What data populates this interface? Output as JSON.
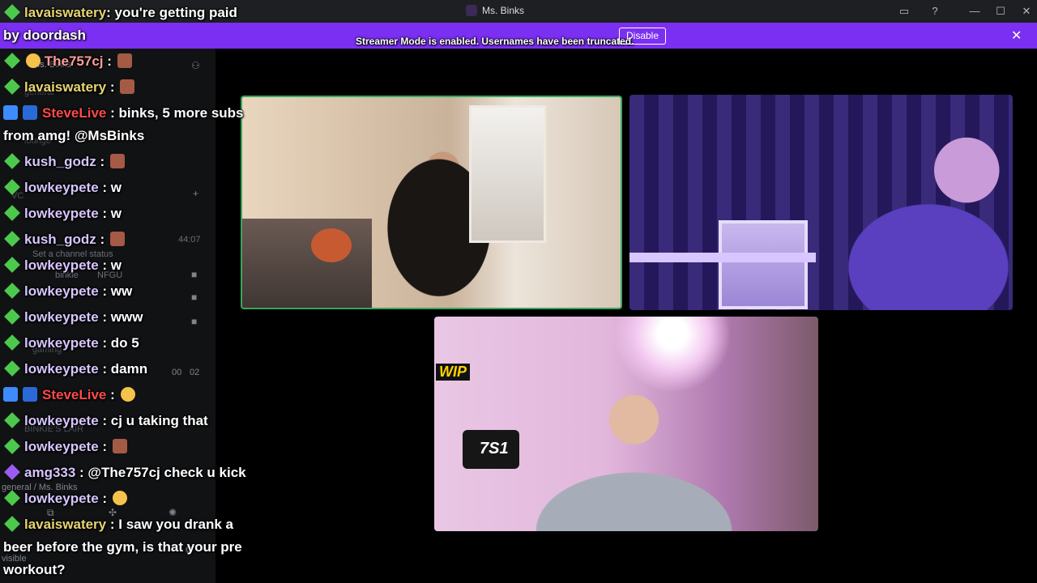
{
  "window": {
    "title": "Ms. Binks",
    "controls": [
      "minimize-icon",
      "maximize-icon",
      "close-icon"
    ],
    "inbox_icon": "inbox-icon",
    "help_icon": "help-icon"
  },
  "notice": {
    "message": "Streamer Mode is enabled. Usernames have been truncated.",
    "button": "Disable",
    "background": "#7b2ff2"
  },
  "sidebar": {
    "server": "Ms. Binks",
    "lines": [
      "general",
      "lounge",
      "VC",
      "Set a channel status",
      "binkie",
      "NFGU",
      "44:07",
      "gaming",
      "BINKIE'S LAIR",
      "general / Ms. Binks",
      "visible",
      "00",
      "02"
    ]
  },
  "chat": [
    {
      "user": "lavaiswatery",
      "text": ": you're getting paid",
      "cont": "by doordash",
      "color": "gold"
    },
    {
      "user": "The757cj",
      "text": " : ",
      "emote": true,
      "color": "pink"
    },
    {
      "user": "lavaiswatery",
      "text": " : ",
      "emote": true,
      "color": "gold"
    },
    {
      "user": "SteveLive",
      "text": " : binks, 5 more subs",
      "cont": "from amg! @MsBinks",
      "color": "red"
    },
    {
      "user": "kush_godz",
      "text": " : ",
      "emote": true,
      "color": "lav"
    },
    {
      "user": "lowkeypete",
      "text": " : w",
      "color": "lav"
    },
    {
      "user": "lowkeypete",
      "text": " : w",
      "color": "lav"
    },
    {
      "user": "kush_godz",
      "text": " : ",
      "emote": true,
      "color": "lav"
    },
    {
      "user": "lowkeypete",
      "text": " : w",
      "color": "lav"
    },
    {
      "user": "lowkeypete",
      "text": " : ww",
      "color": "lav"
    },
    {
      "user": "lowkeypete",
      "text": " : www",
      "color": "lav"
    },
    {
      "user": "lowkeypete",
      "text": " : do 5",
      "color": "lav"
    },
    {
      "user": "lowkeypete",
      "text": " : damn",
      "color": "lav"
    },
    {
      "user": "SteveLive",
      "text": " : ",
      "emote_face": true,
      "color": "red"
    },
    {
      "user": "lowkeypete",
      "text": " : cj u taking that",
      "color": "lav"
    },
    {
      "user": "lowkeypete",
      "text": " : ",
      "emote": true,
      "color": "lav"
    },
    {
      "user": "amg333",
      "text": " : @The757cj check u kick",
      "color": "lav"
    },
    {
      "user": "lowkeypete",
      "text": " : ",
      "emote_face": true,
      "color": "lav"
    },
    {
      "user": "lavaiswatery",
      "text": " : I saw you drank a",
      "cont": "beer before the gym, is that your pre",
      "cont2": "workout?",
      "color": "gold"
    }
  ],
  "video": {
    "tile_a_border": "#3ba55c",
    "mic_logo": "7S1",
    "sign": "WIP"
  }
}
